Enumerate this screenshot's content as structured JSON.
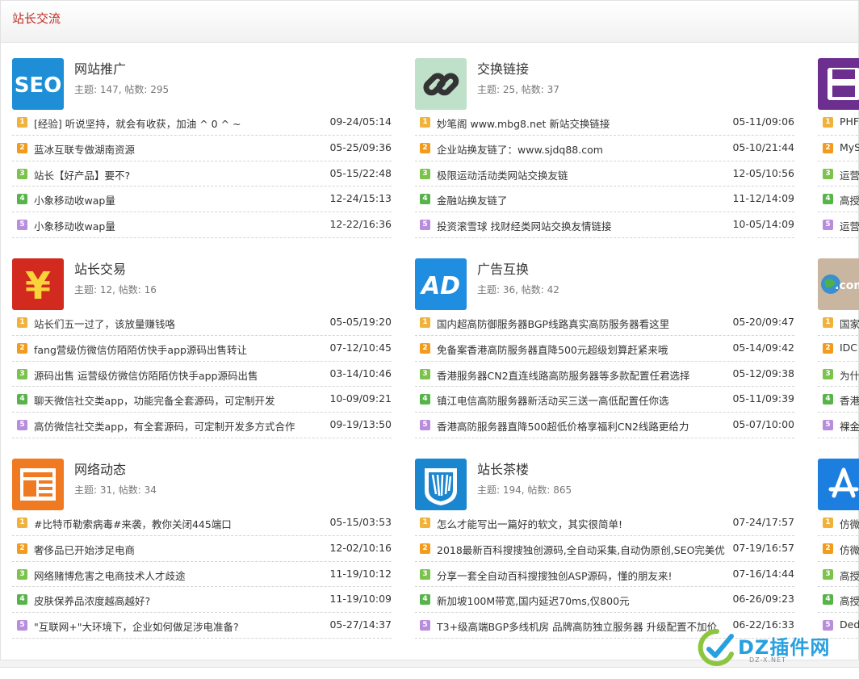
{
  "section": {
    "title": "站长交流"
  },
  "forums": [
    {
      "name": "网站推广",
      "stats": "主题: 147, 帖数: 295",
      "icon": "seo-icon",
      "threads": [
        {
          "t": "[经验] 听说坚持，就会有收获，加油 ^ 0 ^ ~",
          "d": "09-24/05:14"
        },
        {
          "t": "蓝冰互联专做湖南资源",
          "d": "05-25/09:36"
        },
        {
          "t": "站长【好产品】要不?",
          "d": "05-15/22:48"
        },
        {
          "t": "小象移动收wap量",
          "d": "12-24/15:13"
        },
        {
          "t": "小象移动收wap量",
          "d": "12-22/16:36"
        }
      ]
    },
    {
      "name": "交换链接",
      "stats": "主题: 25, 帖数: 37",
      "icon": "chain-link-icon",
      "threads": [
        {
          "t": "妙笔阁 www.mbg8.net 新站交换链接",
          "d": "05-11/09:06"
        },
        {
          "t": "企业站换友链了：www.sjdq88.com",
          "d": "05-10/21:44"
        },
        {
          "t": "极限运动活动类网站交换友链",
          "d": "12-05/10:56"
        },
        {
          "t": "金融站换友链了",
          "d": "11-12/14:09"
        },
        {
          "t": "投资滚雪球 找财经类网站交换友情链接",
          "d": "10-05/14:09"
        }
      ]
    },
    {
      "name": "站长交易",
      "stats": "主题: 12, 帖数: 16",
      "icon": "yuan-icon",
      "threads": [
        {
          "t": "站长们五一过了，该放量赚钱咯",
          "d": "05-05/19:20"
        },
        {
          "t": "fang营级仿微信仿陌陌仿快手app源码出售转让",
          "d": "07-12/10:45"
        },
        {
          "t": "源码出售 运营级仿微信仿陌陌仿快手app源码出售",
          "d": "03-14/10:46"
        },
        {
          "t": "聊天微信社交类app，功能完备全套源码，可定制开发",
          "d": "10-09/09:21"
        },
        {
          "t": "高仿微信社交类app，有全套源码，可定制开发多方式合作",
          "d": "09-19/13:50"
        }
      ]
    },
    {
      "name": "广告互换",
      "stats": "主题: 36, 帖数: 42",
      "icon": "ad-icon",
      "threads": [
        {
          "t": "国内超高防御服务器BGP线路真实高防服务器看这里",
          "d": "05-20/09:47"
        },
        {
          "t": "免备案香港高防服务器直降500元超级划算赶紧来哦",
          "d": "05-14/09:42"
        },
        {
          "t": "香港服务器CN2直连线路高防服务器等多款配置任君选择",
          "d": "05-12/09:38"
        },
        {
          "t": "镇江电信高防服务器新活动买三送一高低配置任你选",
          "d": "05-11/09:39"
        },
        {
          "t": "香港高防服务器直降500超低价格享福利CN2线路更给力",
          "d": "05-07/10:00"
        }
      ]
    },
    {
      "name": "网络动态",
      "stats": "主题: 31, 帖数: 34",
      "icon": "news-icon",
      "threads": [
        {
          "t": "#比特币勒索病毒#来袭，教你关闭445端口",
          "d": "05-15/03:53"
        },
        {
          "t": "奢侈品已开始涉足电商",
          "d": "12-02/10:16"
        },
        {
          "t": "网络赌博危害之电商技术人才歧途",
          "d": "11-19/10:12"
        },
        {
          "t": "皮肤保养品浓度越高越好?",
          "d": "11-19/10:09"
        },
        {
          "t": "\"互联网+\"大环境下，企业如何做足涉电准备?",
          "d": "05-27/14:37"
        }
      ]
    },
    {
      "name": "站长茶楼",
      "stats": "主题: 194, 帖数: 865",
      "icon": "shield-book-icon",
      "threads": [
        {
          "t": "怎么才能写出一篇好的软文，其实很简单!",
          "d": "07-24/17:57"
        },
        {
          "t": "2018最新百科搜搜独创源码,全自动采集,自动伪原创,SEO完美优",
          "d": "07-19/16:57"
        },
        {
          "t": "分享一套全自动百科搜搜独创ASP源码，懂的朋友来!",
          "d": "07-16/14:44"
        },
        {
          "t": "新加坡100M带宽,国内延迟70ms,仅800元",
          "d": "06-26/09:23"
        },
        {
          "t": "T3+级高端BGP多线机房 品牌高防独立服务器 升级配置不加价",
          "d": "06-22/16:33"
        }
      ]
    }
  ],
  "partial_col": [
    {
      "icon": "floppy-icon",
      "threads": [
        "PHF",
        "MyS",
        "运营",
        "高授",
        "运营"
      ]
    },
    {
      "icon": "globe-com-icon",
      "threads": [
        "国家",
        "IDC",
        "为什",
        "香港",
        "裸金"
      ]
    },
    {
      "icon": "app-store-icon",
      "threads": [
        "仿微",
        "仿微",
        "高授",
        "高授",
        "Ded"
      ]
    }
  ],
  "watermark": {
    "text": "DZ插件网",
    "sub": "DZ-X.NET"
  },
  "colors": {
    "title_red": "#c12a1e",
    "wm_blue": "#27a0e0"
  }
}
